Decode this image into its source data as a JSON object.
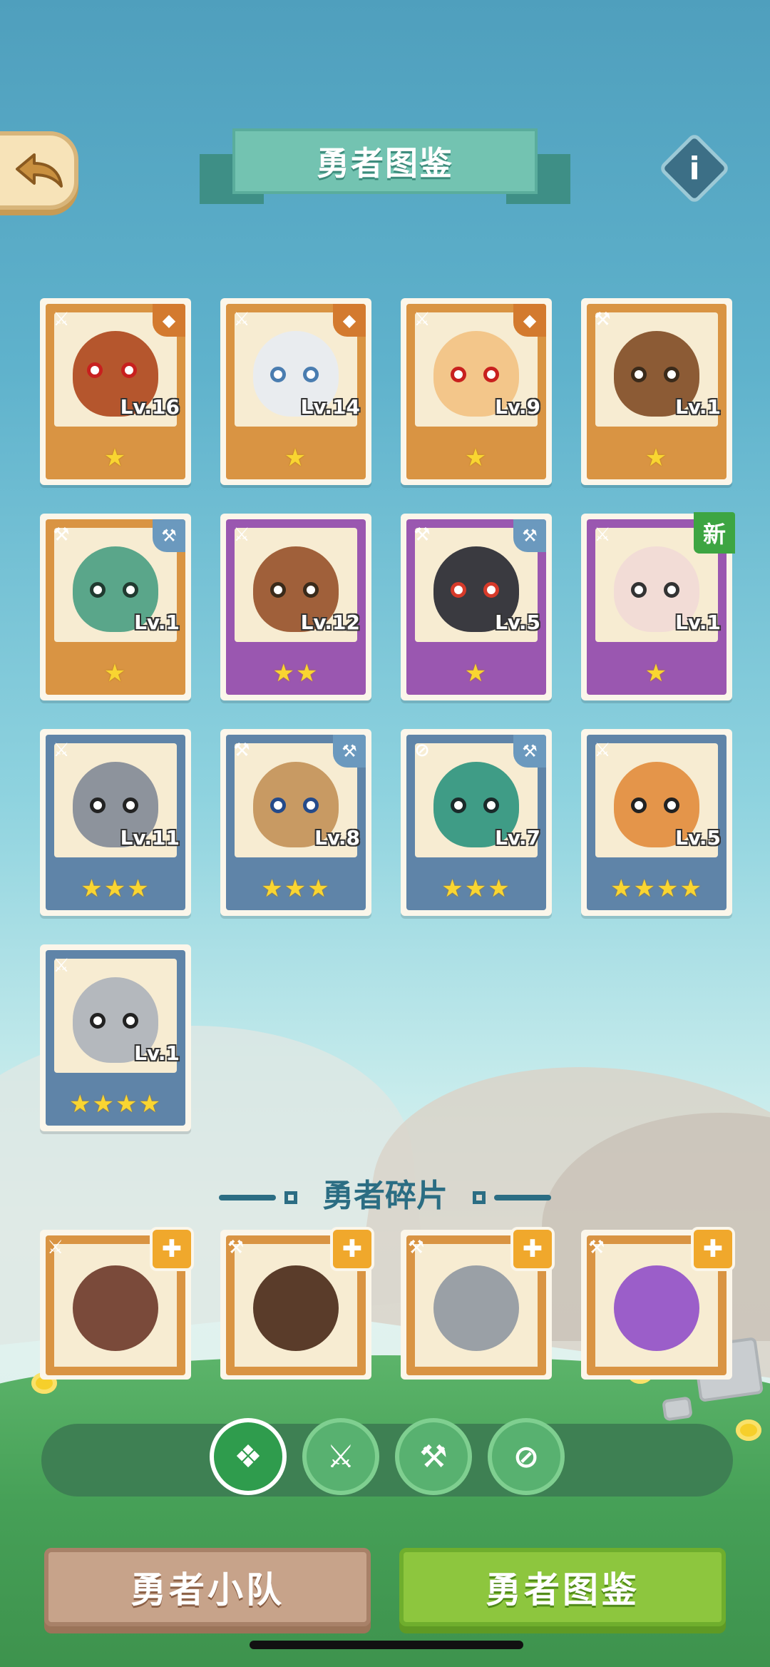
{
  "header": {
    "title": "勇者图鉴"
  },
  "heroes": [
    {
      "lv": "Lv.16",
      "stars": "★",
      "color": "orange"
    },
    {
      "lv": "Lv.14",
      "stars": "★",
      "color": "orange"
    },
    {
      "lv": "Lv.9",
      "stars": "★",
      "color": "orange"
    },
    {
      "lv": "Lv.1",
      "stars": "★",
      "color": "orange"
    },
    {
      "lv": "Lv.1",
      "stars": "★",
      "color": "orange"
    },
    {
      "lv": "Lv.12",
      "stars": "★★",
      "color": "purple"
    },
    {
      "lv": "Lv.5",
      "stars": "★",
      "color": "purple"
    },
    {
      "lv": "Lv.1",
      "stars": "★",
      "color": "purple",
      "badge": "新"
    },
    {
      "lv": "Lv.11",
      "stars": "★★★",
      "color": "blue"
    },
    {
      "lv": "Lv.8",
      "stars": "★★★",
      "color": "blue"
    },
    {
      "lv": "Lv.7",
      "stars": "★★★",
      "color": "blue"
    },
    {
      "lv": "Lv.5",
      "stars": "★★★★",
      "color": "blue"
    },
    {
      "lv": "Lv.1",
      "stars": "★★★★",
      "color": "blue"
    }
  ],
  "fragments": {
    "title": "勇者碎片"
  },
  "bottom": {
    "team_label": "勇者小队",
    "codex_label": "勇者图鉴"
  }
}
